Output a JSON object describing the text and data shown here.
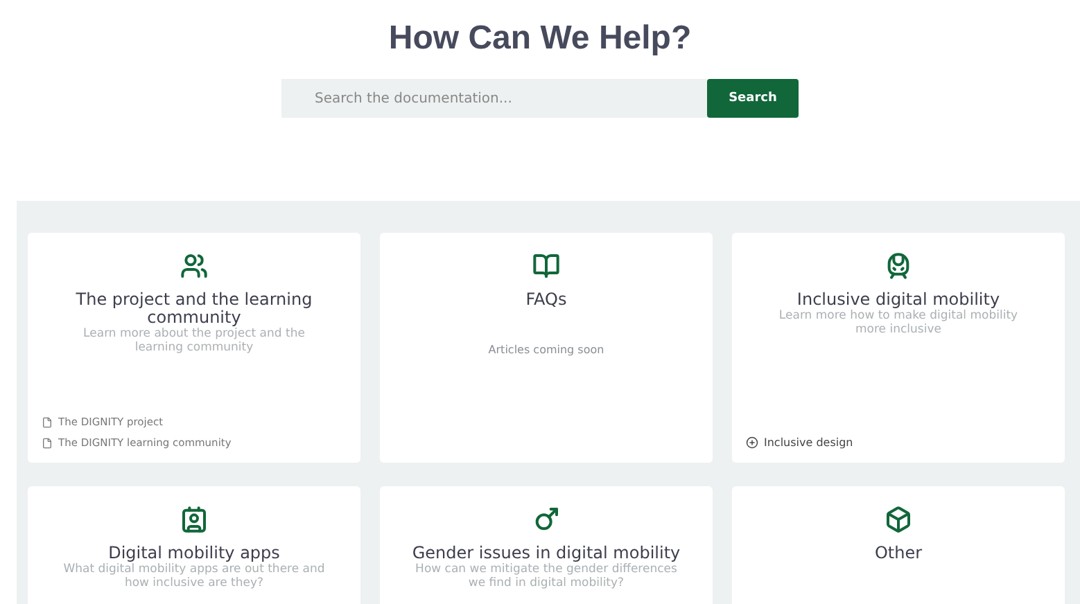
{
  "heading": "How Can We Help?",
  "search": {
    "placeholder": "Search the documentation...",
    "button": "Search"
  },
  "categories": [
    {
      "title": "The project and the learning community",
      "description": "Learn more about the project and the learning community",
      "links": [
        {
          "kind": "document",
          "label": "The DIGNITY project"
        },
        {
          "kind": "document",
          "label": "The DIGNITY learning community"
        }
      ]
    },
    {
      "title": "FAQs",
      "note": "Articles coming soon"
    },
    {
      "title": "Inclusive digital mobility",
      "description": "Learn more how to make digital mobility more inclusive",
      "links": [
        {
          "kind": "section",
          "label": "Inclusive design"
        }
      ]
    },
    {
      "title": "Digital mobility apps",
      "description": "What digital mobility apps are out there and how inclusive are they?"
    },
    {
      "title": "Gender issues in digital mobility",
      "description": "How can we mitigate the gender differences we find in digital mobility?"
    },
    {
      "title": "Other"
    }
  ]
}
